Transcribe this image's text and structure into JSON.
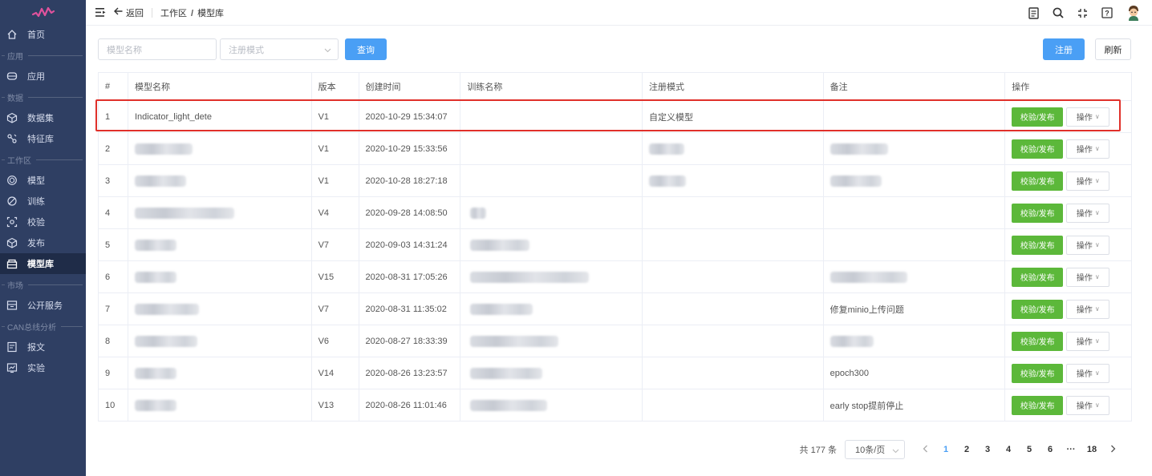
{
  "sidebar": {
    "items": [
      {
        "label": "首页",
        "icon": "home-icon"
      },
      {
        "group": "应用"
      },
      {
        "label": "应用",
        "icon": "app-icon"
      },
      {
        "group": "数据"
      },
      {
        "label": "数据集",
        "icon": "dataset-icon"
      },
      {
        "label": "特征库",
        "icon": "feature-icon"
      },
      {
        "group": "工作区"
      },
      {
        "label": "模型",
        "icon": "model-icon"
      },
      {
        "label": "训练",
        "icon": "train-icon"
      },
      {
        "label": "校验",
        "icon": "check-icon"
      },
      {
        "label": "发布",
        "icon": "publish-icon"
      },
      {
        "label": "模型库",
        "icon": "model-library-icon",
        "active": true
      },
      {
        "group": "市场"
      },
      {
        "label": "公开服务",
        "icon": "public-service-icon"
      },
      {
        "group": "CAN总线分析"
      },
      {
        "label": "报文",
        "icon": "message-icon"
      },
      {
        "label": "实验",
        "icon": "experiment-icon"
      }
    ]
  },
  "topbar": {
    "back_label": "返回",
    "breadcrumb": [
      "工作区",
      "模型库"
    ]
  },
  "filters": {
    "name_placeholder": "模型名称",
    "mode_placeholder": "注册模式",
    "query_label": "查询",
    "register_label": "注册",
    "refresh_label": "刷新"
  },
  "table": {
    "columns": [
      "#",
      "模型名称",
      "版本",
      "创建时间",
      "训练名称",
      "注册模式",
      "备注",
      "操作"
    ],
    "publish_label": "校验/发布",
    "op_label": "操作",
    "rows": [
      {
        "idx": "1",
        "name": "Indicator_light_dete",
        "version": "V1",
        "created": "2020-10-29 15:34:07",
        "train": "",
        "mode": "自定义模型",
        "note": ""
      },
      {
        "idx": "2",
        "name": null,
        "version": "V1",
        "created": "2020-10-29 15:33:56",
        "train": "",
        "mode": null,
        "note": null
      },
      {
        "idx": "3",
        "name": null,
        "version": "V1",
        "created": "2020-10-28 18:27:18",
        "train": "",
        "mode": null,
        "note": null
      },
      {
        "idx": "4",
        "name": null,
        "version": "V4",
        "created": "2020-09-28 14:08:50",
        "train": null,
        "mode": "",
        "note": ""
      },
      {
        "idx": "5",
        "name": null,
        "version": "V7",
        "created": "2020-09-03 14:31:24",
        "train": null,
        "mode": "",
        "note": ""
      },
      {
        "idx": "6",
        "name": null,
        "version": "V15",
        "created": "2020-08-31 17:05:26",
        "train": null,
        "mode": "",
        "note": null
      },
      {
        "idx": "7",
        "name": null,
        "version": "V7",
        "created": "2020-08-31 11:35:02",
        "train": null,
        "mode": "",
        "note": "修复minio上传问题"
      },
      {
        "idx": "8",
        "name": null,
        "version": "V6",
        "created": "2020-08-27 18:33:39",
        "train": null,
        "mode": "",
        "note": null
      },
      {
        "idx": "9",
        "name": null,
        "version": "V14",
        "created": "2020-08-26 13:23:57",
        "train": null,
        "mode": "",
        "note": "epoch300"
      },
      {
        "idx": "10",
        "name": null,
        "version": "V13",
        "created": "2020-08-26 11:01:46",
        "train": null,
        "mode": "",
        "note": "early stop提前停止"
      }
    ]
  },
  "pagination": {
    "total": "共 177 条",
    "page_size": "10条/页",
    "pages": [
      "1",
      "2",
      "3",
      "4",
      "5",
      "6",
      "···",
      "18"
    ],
    "current": "1"
  },
  "colors": {
    "sidebar_bg": "#2f3f63",
    "primary": "#4a9ff5",
    "success": "#5cb83a",
    "highlight": "#e0302a"
  }
}
